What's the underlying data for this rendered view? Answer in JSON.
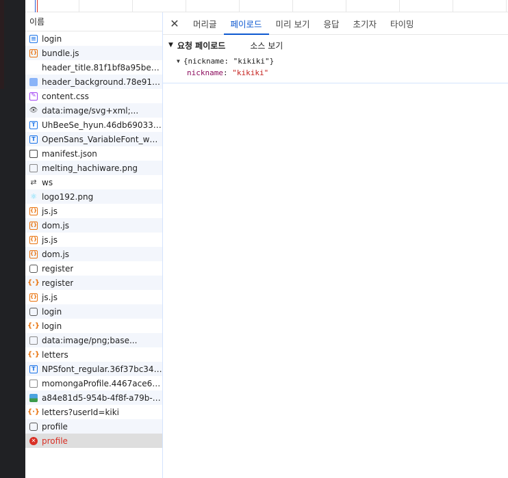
{
  "timeline": {},
  "name_panel": {
    "header": "이름",
    "requests": [
      {
        "name": "login",
        "icon": "document-icon"
      },
      {
        "name": "bundle.js",
        "icon": "script-icon"
      },
      {
        "name": "header_title.81f1bf8a95be5f40...",
        "icon": "image-icon"
      },
      {
        "name": "header_background.78e91a9fc...",
        "icon": "image-icon"
      },
      {
        "name": "content.css",
        "icon": "stylesheet-icon"
      },
      {
        "name": "data:image/svg+xml;...",
        "icon": "svg-icon"
      },
      {
        "name": "UhBeeSe_hyun.46db69033766...",
        "icon": "font-icon"
      },
      {
        "name": "OpenSans_VariableFont_wdth_...",
        "icon": "font-icon"
      },
      {
        "name": "manifest.json",
        "icon": "manifest-icon"
      },
      {
        "name": "melting_hachiware.png",
        "icon": "image-icon"
      },
      {
        "name": "ws",
        "icon": "websocket-icon"
      },
      {
        "name": "logo192.png",
        "icon": "image-icon"
      },
      {
        "name": "js.js",
        "icon": "script-icon"
      },
      {
        "name": "dom.js",
        "icon": "script-icon"
      },
      {
        "name": "js.js",
        "icon": "script-icon"
      },
      {
        "name": "dom.js",
        "icon": "script-icon"
      },
      {
        "name": "register",
        "icon": "preflight-icon"
      },
      {
        "name": "register",
        "icon": "fetch-icon"
      },
      {
        "name": "js.js",
        "icon": "script-icon"
      },
      {
        "name": "login",
        "icon": "preflight-icon"
      },
      {
        "name": "login",
        "icon": "fetch-icon"
      },
      {
        "name": "data:image/png;base...",
        "icon": "image-icon"
      },
      {
        "name": "letters",
        "icon": "fetch-icon"
      },
      {
        "name": "NPSfont_regular.36f37bc346f1...",
        "icon": "font-icon"
      },
      {
        "name": "momongaProfile.4467ace69ba...",
        "icon": "image-icon"
      },
      {
        "name": "a84e81d5-954b-4f8f-a79b-d4...",
        "icon": "image-icon"
      },
      {
        "name": "letters?userId=kiki",
        "icon": "fetch-icon"
      },
      {
        "name": "profile",
        "icon": "preflight-icon"
      },
      {
        "name": "profile",
        "icon": "error-icon"
      }
    ]
  },
  "detail": {
    "close_icon": "close-icon",
    "tabs": [
      "머리글",
      "페이로드",
      "미리 보기",
      "응답",
      "초기자",
      "타이밍"
    ],
    "active_tab": "페이로드",
    "payload": {
      "section_title": "요청 페이로드",
      "view_source": "소스 보기",
      "object_summary": "{nickname: \"kikiki\"}",
      "fields": [
        {
          "key": "nickname",
          "value": "\"kikiki\""
        }
      ]
    }
  },
  "colors": {
    "accent": "#0b57d0",
    "error": "#d93025",
    "row_stripe": "#f3f6fc",
    "selected_row": "#dedede"
  }
}
